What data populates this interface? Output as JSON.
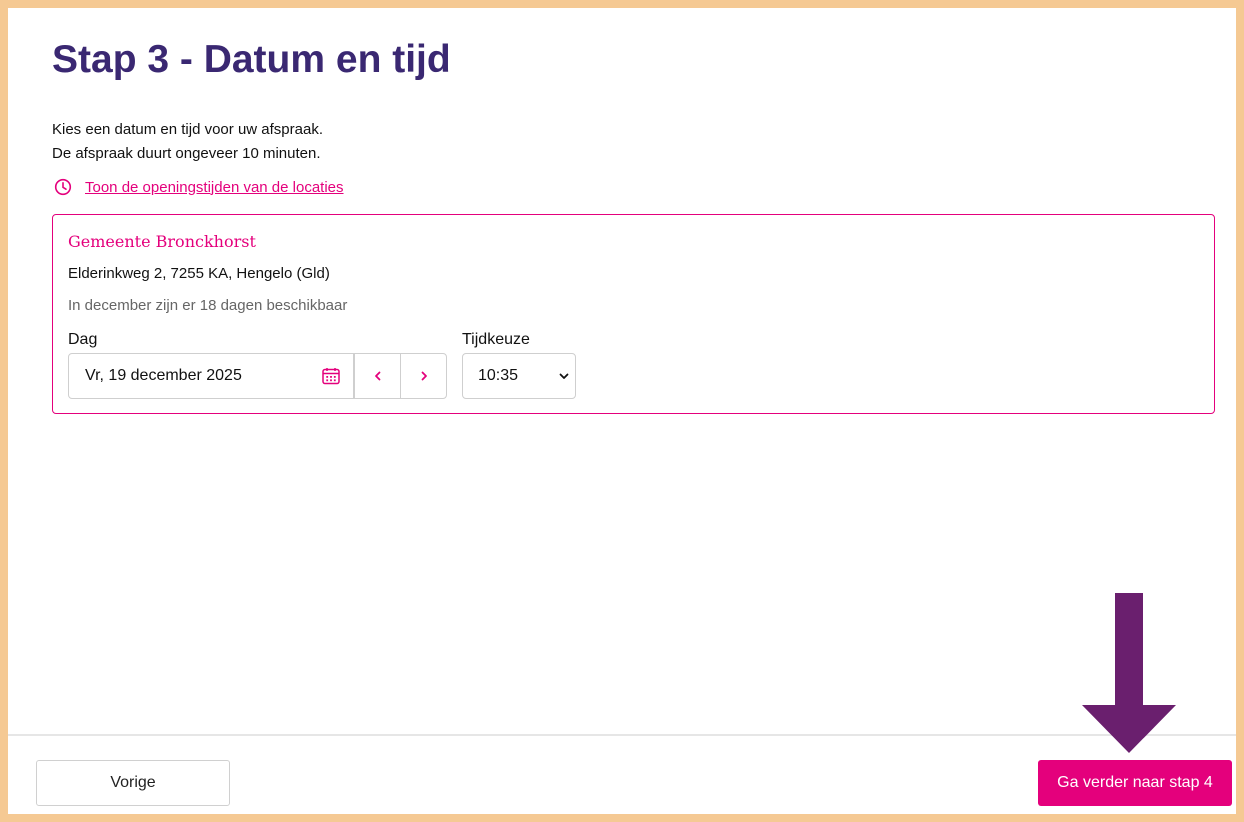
{
  "page": {
    "title": "Stap 3 - Datum en tijd",
    "intro_line1": "Kies een datum en tijd voor uw afspraak.",
    "intro_line2": "De afspraak duurt ongeveer 10 minuten.",
    "hours_link": "Toon de openingstijden van de locaties"
  },
  "location": {
    "name": "Gemeente Bronckhorst",
    "address": "Elderinkweg 2, 7255 KA, Hengelo (Gld)",
    "availability": "In december zijn er 18 dagen beschikbaar"
  },
  "date_picker": {
    "label": "Dag",
    "value": "Vr, 19 december 2025",
    "icon": "calendar-icon",
    "prev_icon": "chevron-left-icon",
    "next_icon": "chevron-right-icon"
  },
  "time_picker": {
    "label": "Tijdkeuze",
    "value": "10:35",
    "icon": "chevron-down-icon"
  },
  "footer": {
    "prev_label": "Vorige",
    "next_label": "Ga verder naar stap 4"
  },
  "colors": {
    "accent": "#e4007c",
    "title": "#3a2872",
    "frame": "#f5c993",
    "annotation_arrow": "#6a1f6e"
  }
}
